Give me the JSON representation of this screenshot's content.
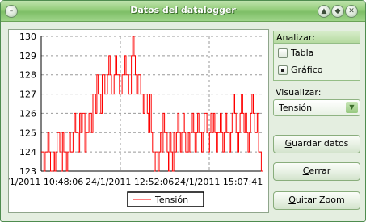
{
  "window": {
    "title": "Datos del datalogger",
    "controls": [
      "minimize-icon",
      "maximize-icon",
      "close-icon"
    ]
  },
  "panel": {
    "analyze": {
      "title": "Analizar:",
      "options": [
        {
          "label": "Tabla",
          "selected": false
        },
        {
          "label": "Gráfico",
          "selected": true
        }
      ]
    },
    "visualize": {
      "label": "Visualizar:",
      "selected": "Tensión"
    },
    "buttons": {
      "save": {
        "pre": "",
        "key": "G",
        "post": "uardar datos"
      },
      "close": {
        "pre": "",
        "key": "C",
        "post": "errar"
      },
      "zoom": {
        "pre": "",
        "key": "Q",
        "post": "uitar Zoom"
      }
    }
  },
  "chart_data": {
    "type": "line",
    "series": [
      {
        "name": "Tensión",
        "color": "#ff0000"
      }
    ],
    "y_ticks": [
      123,
      124,
      125,
      126,
      127,
      128,
      129,
      130
    ],
    "ylim": [
      123,
      130
    ],
    "x_tick_labels": [
      "/1/2011 10:48:06",
      "24/1/2011 12:52:06",
      "24/1/2011 15:07:41"
    ],
    "grid": true,
    "legend_position": "bottom",
    "values": [
      124,
      124,
      123,
      124,
      124,
      125,
      124,
      123,
      123,
      124,
      123,
      124,
      125,
      125,
      124,
      123,
      125,
      124,
      124,
      123,
      124,
      125,
      124,
      124,
      125,
      126,
      125,
      125,
      124,
      126,
      125,
      126,
      126,
      124,
      125,
      125,
      126,
      126,
      125,
      127,
      127,
      126,
      128,
      127,
      127,
      126,
      128,
      128,
      127,
      127,
      128,
      129,
      128,
      127,
      127,
      128,
      129,
      128,
      128,
      127,
      127,
      128,
      128,
      129,
      128,
      128,
      127,
      127,
      129,
      130,
      129,
      128,
      127,
      128,
      128,
      127,
      127,
      126,
      127,
      127,
      126,
      125,
      127,
      125,
      124,
      123,
      124,
      124,
      123,
      124,
      125,
      124,
      126,
      125,
      125,
      124,
      123,
      125,
      124,
      123,
      125,
      124,
      125,
      126,
      125,
      124,
      125,
      126,
      125,
      124,
      124,
      125,
      124,
      125,
      126,
      125,
      124,
      125,
      126,
      125,
      125,
      124,
      125,
      126,
      126,
      125,
      124,
      125,
      126,
      125,
      126,
      125,
      124,
      125,
      125,
      126,
      125,
      124,
      125,
      126,
      125,
      125,
      124,
      125,
      126,
      127,
      126,
      125,
      124,
      125,
      126,
      127,
      126,
      125,
      126,
      125,
      124,
      125,
      126,
      127,
      126,
      125,
      125,
      126,
      124,
      124,
      123
    ]
  }
}
